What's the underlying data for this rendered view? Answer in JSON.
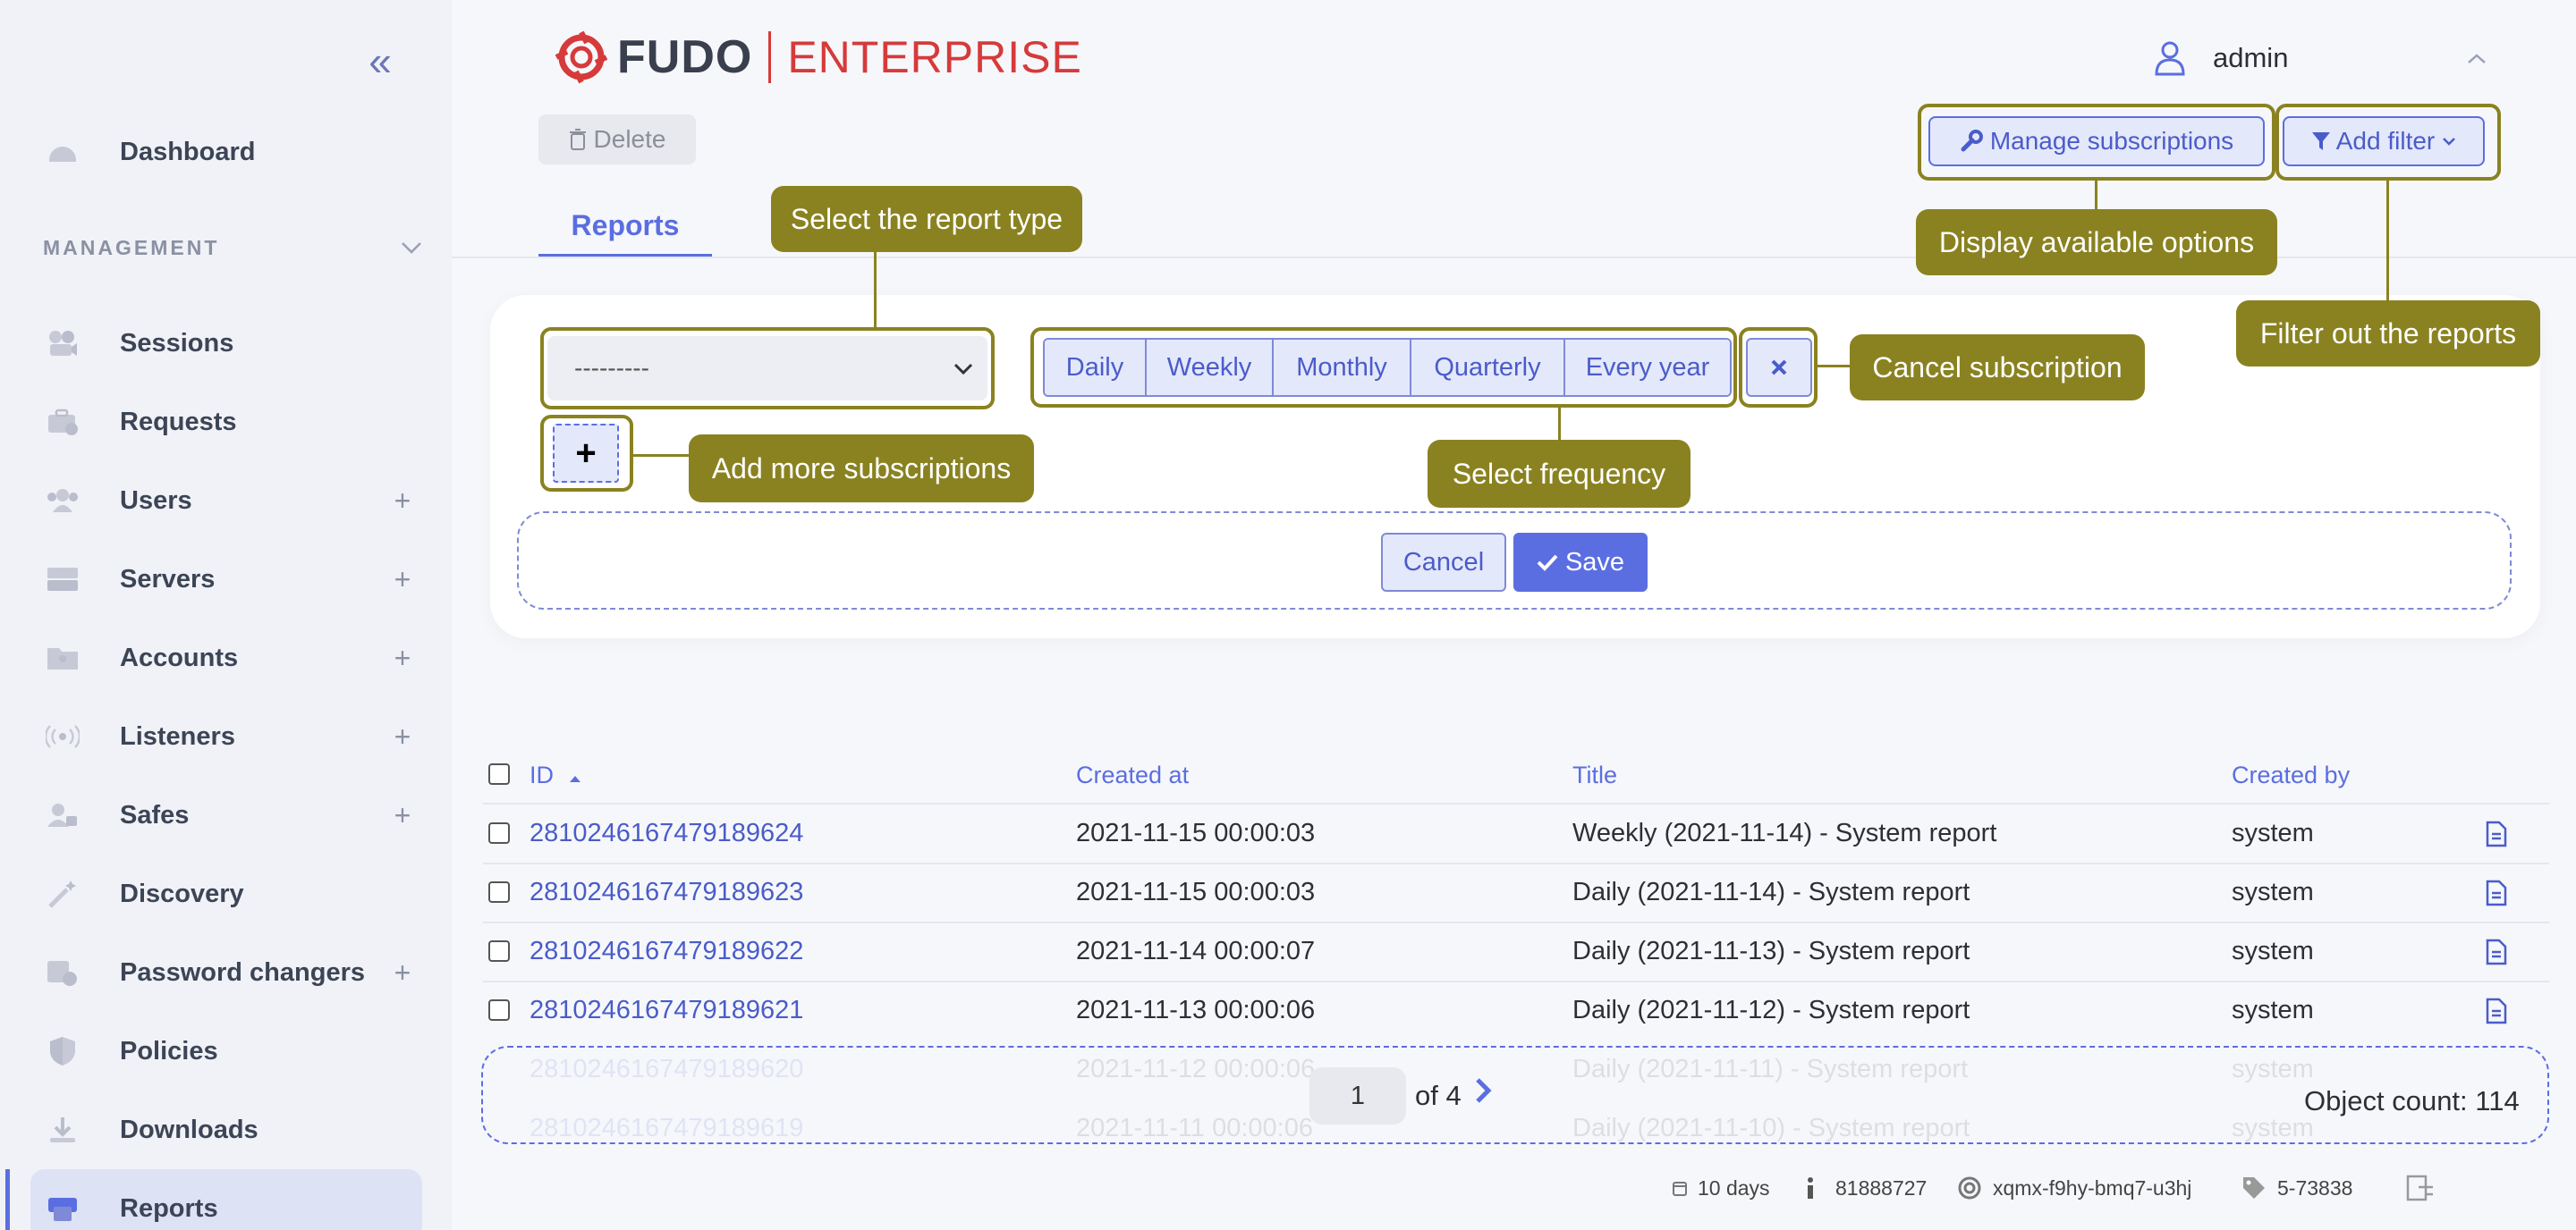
{
  "sidebar": {
    "section_label": "MANAGEMENT",
    "items": [
      {
        "label": "Dashboard"
      },
      {
        "label": "Sessions"
      },
      {
        "label": "Requests"
      },
      {
        "label": "Users"
      },
      {
        "label": "Servers"
      },
      {
        "label": "Accounts"
      },
      {
        "label": "Listeners"
      },
      {
        "label": "Safes"
      },
      {
        "label": "Discovery"
      },
      {
        "label": "Password changers"
      },
      {
        "label": "Policies"
      },
      {
        "label": "Downloads"
      },
      {
        "label": "Reports"
      }
    ],
    "active_item": "Reports"
  },
  "header": {
    "logo_text": "FUDO",
    "logo_suffix": "ENTERPRISE",
    "username": "admin"
  },
  "toolbar": {
    "delete_label": "Delete",
    "manage_label": "Manage subscriptions",
    "filter_label": "Add filter"
  },
  "tabs": {
    "reports_label": "Reports"
  },
  "subscription": {
    "select_value": "---------",
    "frequencies": [
      "Daily",
      "Weekly",
      "Monthly",
      "Quarterly",
      "Every year"
    ],
    "add_label": "+",
    "cancel_label": "Cancel",
    "save_label": "Save"
  },
  "callouts": {
    "report_type": "Select the report type",
    "display_options": "Display available options",
    "filter_reports": "Filter out the reports",
    "cancel_subscription": "Cancel subscription",
    "add_more": "Add more subscriptions",
    "select_frequency": "Select frequency"
  },
  "table": {
    "headers": [
      "ID",
      "Created at",
      "Title",
      "Created by"
    ],
    "rows": [
      {
        "id": "2810246167479189624",
        "created_at": "2021-11-15 00:00:03",
        "title": "Weekly (2021-11-14) - System report",
        "created_by": "system"
      },
      {
        "id": "2810246167479189623",
        "created_at": "2021-11-15 00:00:03",
        "title": "Daily (2021-11-14) - System report",
        "created_by": "system"
      },
      {
        "id": "2810246167479189622",
        "created_at": "2021-11-14 00:00:07",
        "title": "Daily (2021-11-13) - System report",
        "created_by": "system"
      },
      {
        "id": "2810246167479189621",
        "created_at": "2021-11-13 00:00:06",
        "title": "Daily (2021-11-12) - System report",
        "created_by": "system"
      },
      {
        "id": "2810246167479189620",
        "created_at": "2021-11-12 00:00:06",
        "title": "Daily (2021-11-11) - System report",
        "created_by": "system"
      },
      {
        "id": "2810246167479189619",
        "created_at": "2021-11-11 00:00:06",
        "title": "Daily (2021-11-10) - System report",
        "created_by": "system"
      }
    ]
  },
  "pagination": {
    "current_page": "1",
    "of_label": "of 4",
    "object_count": "Object count: 114"
  },
  "footer": {
    "uptime": "10 days",
    "info": "81888727",
    "node": "xqmx-f9hy-bmq7-u3hj",
    "version": "5-73838"
  },
  "colors": {
    "accent": "#5b6ee1",
    "callout": "#8a8221",
    "brand_red": "#d63a3a"
  }
}
